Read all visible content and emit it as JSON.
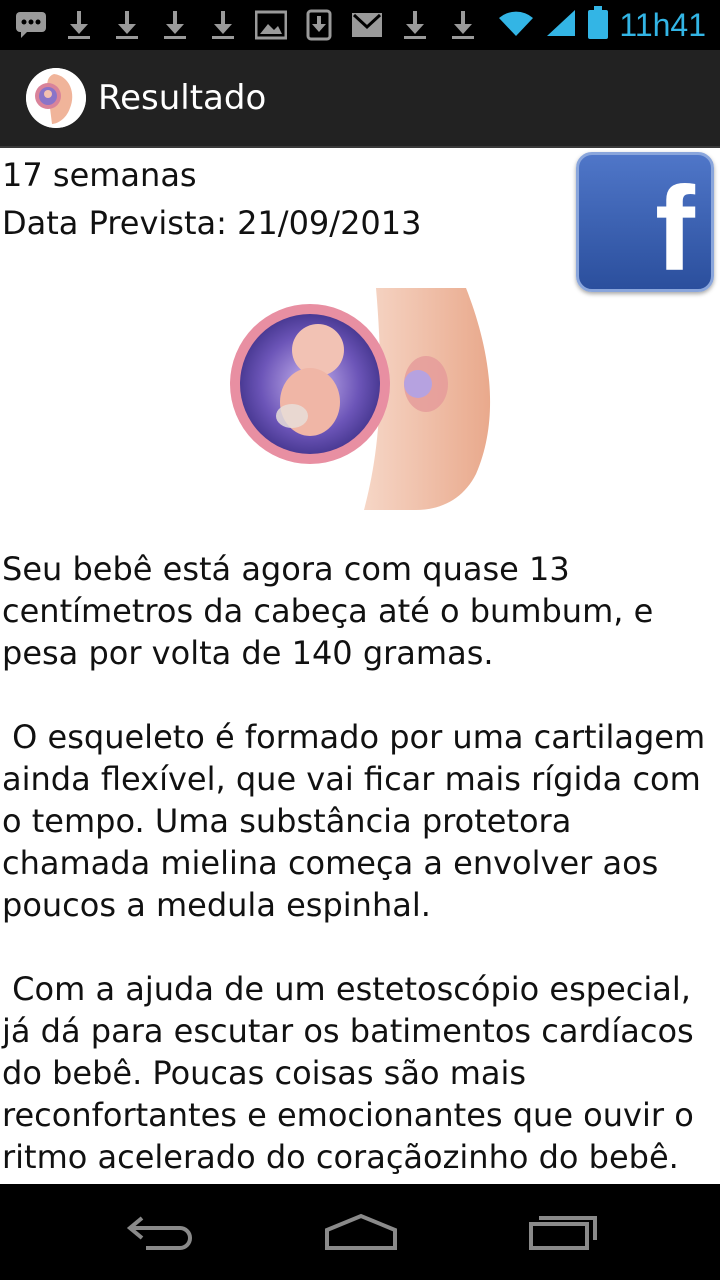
{
  "status_bar": {
    "time": "11h41",
    "icons": [
      "message-icon",
      "download-icon",
      "download-icon",
      "download-icon",
      "download-icon",
      "image-icon",
      "download-box-icon",
      "gmail-icon",
      "download-icon",
      "download-icon"
    ]
  },
  "action_bar": {
    "title": "Resultado"
  },
  "result": {
    "weeks": "17 semanas",
    "due_date": "Data Prevista: 21/09/2013",
    "description": "Seu bebê está agora com quase 13 centímetros da cabeça até o bumbum, e pesa por volta de 140 gramas.\n\n O esqueleto é formado por uma cartilagem ainda flexível, que vai ficar mais rígida com o tempo. Uma substância protetora chamada mielina começa a envolver aos poucos a medula espinhal.\n\n Com a ajuda de um estetoscópio especial, já dá para escutar os batimentos cardíacos do bebê. Poucas coisas são mais reconfortantes e emocionantes que ouvir o ritmo acelerado do coraçãozinho do bebê."
  },
  "facebook": {
    "label": "f",
    "color": "#3b5998"
  },
  "colors": {
    "status_accent": "#33b5e5",
    "action_bar": "#222222"
  }
}
